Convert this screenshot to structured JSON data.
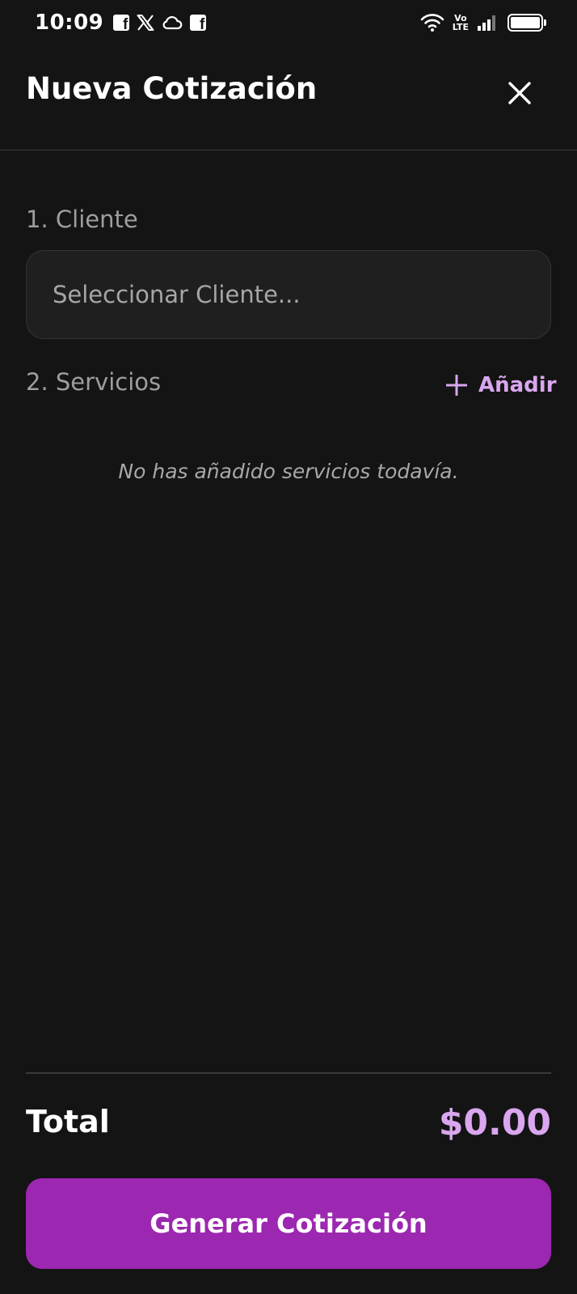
{
  "status_bar": {
    "time": "10:09",
    "notification_icons": [
      "facebook-icon",
      "x-icon",
      "cloud-icon",
      "facebook-icon"
    ],
    "system_icons": [
      "wifi-icon",
      "volte-icon",
      "signal-icon",
      "battery-icon"
    ],
    "volte_top": "Vo",
    "volte_bottom": "LTE"
  },
  "header": {
    "title": "Nueva Cotización",
    "close_icon": "close-icon"
  },
  "client_section": {
    "label": "1. Cliente",
    "select_placeholder": "Seleccionar Cliente..."
  },
  "services_section": {
    "label": "2. Servicios",
    "add_label": "Añadir",
    "add_icon": "plus-icon",
    "empty_message": "No has añadido servicios todavía."
  },
  "footer": {
    "total_label": "Total",
    "total_value": "$0.00",
    "generate_label": "Generar Cotización"
  },
  "colors": {
    "background": "#141414",
    "accent": "#9c27b0",
    "accent_light": "#d9a6ef",
    "muted_text": "#9e9e9e"
  }
}
